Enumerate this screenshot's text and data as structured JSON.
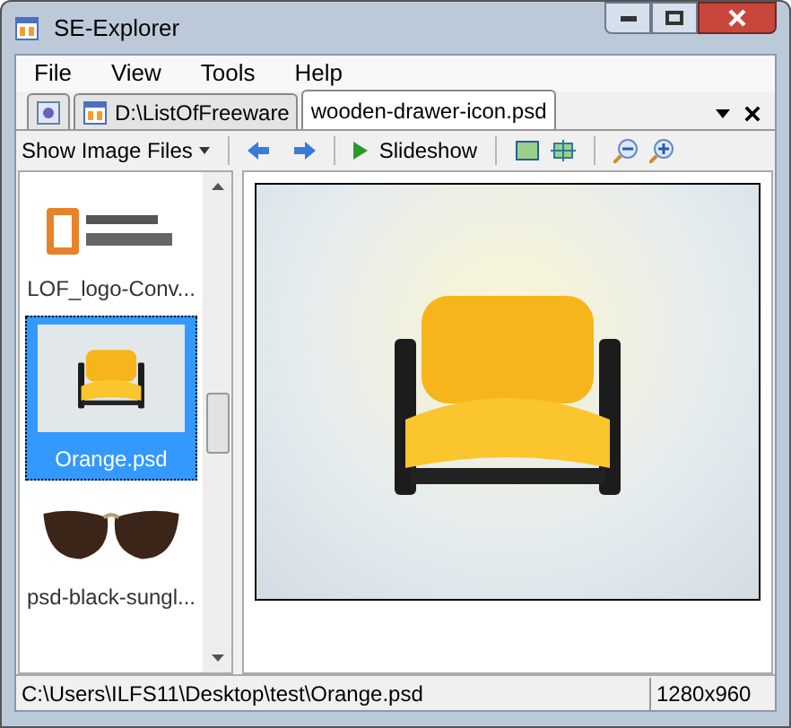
{
  "window": {
    "title": "SE-Explorer"
  },
  "menu": [
    "File",
    "View",
    "Tools",
    "Help"
  ],
  "tabs": [
    {
      "kind": "settings",
      "selected": false
    },
    {
      "kind": "folder",
      "label": "D:\\ListOfFreeware",
      "selected": false
    },
    {
      "kind": "file",
      "label": "wooden-drawer-icon.psd",
      "selected": true
    }
  ],
  "toolbar": {
    "filter": "Show Image Files",
    "slideshow": "Slideshow"
  },
  "thumbnails": [
    {
      "kind": "logo",
      "label": "LOF_logo-Conv...",
      "selected": false
    },
    {
      "kind": "chair",
      "label": "Orange.psd",
      "selected": true
    },
    {
      "kind": "sunglasses",
      "label": "psd-black-sungl...",
      "selected": false
    }
  ],
  "status_bar": {
    "path": "C:\\Users\\ILFS11\\Desktop\\test\\Orange.psd",
    "size": "1280x960"
  }
}
